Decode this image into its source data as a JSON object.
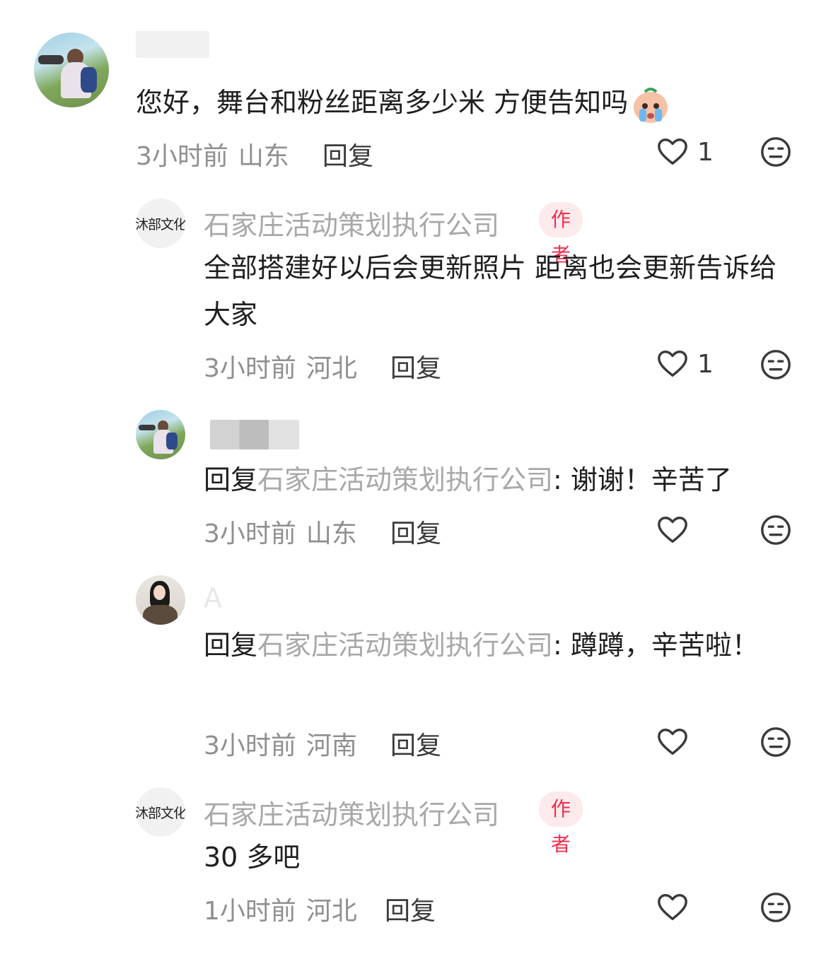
{
  "comments": [
    {
      "name": "",
      "text": "您好，舞台和粉丝距离多少米 方便告知吗",
      "time": "3小时前",
      "location": "山东",
      "reply_label": "回复",
      "likes": "1",
      "emoji_icon": "crying-emoji-icon"
    },
    {
      "name": "石家庄活动策划执行公司",
      "avatar_text": "沐部文化",
      "badge": "作者",
      "text": "全部搭建好以后会更新照片 距离也会更新告诉给大家",
      "time": "3小时前",
      "location": "河北",
      "reply_label": "回复",
      "likes": "1"
    },
    {
      "name": "",
      "reply_prefix": "回复",
      "reply_to": "石家庄活动策划执行公司",
      "text": ": 谢谢！辛苦了",
      "time": "3小时前",
      "location": "山东",
      "reply_label": "回复"
    },
    {
      "name": "A",
      "reply_prefix": "回复",
      "reply_to": "石家庄活动策划执行公司",
      "text": ": 蹲蹲，辛苦啦！",
      "time": "3小时前",
      "location": "河南",
      "reply_label": "回复"
    },
    {
      "name": "石家庄活动策划执行公司",
      "avatar_text": "沐部文化",
      "badge": "作者",
      "text": "30 多吧",
      "time": "1小时前",
      "location": "河北",
      "reply_label": "回复"
    }
  ],
  "colors": {
    "author_badge_bg": "#fdeaec",
    "author_badge_text": "#ee2e4e",
    "name_gray": "#a8a8a8"
  }
}
